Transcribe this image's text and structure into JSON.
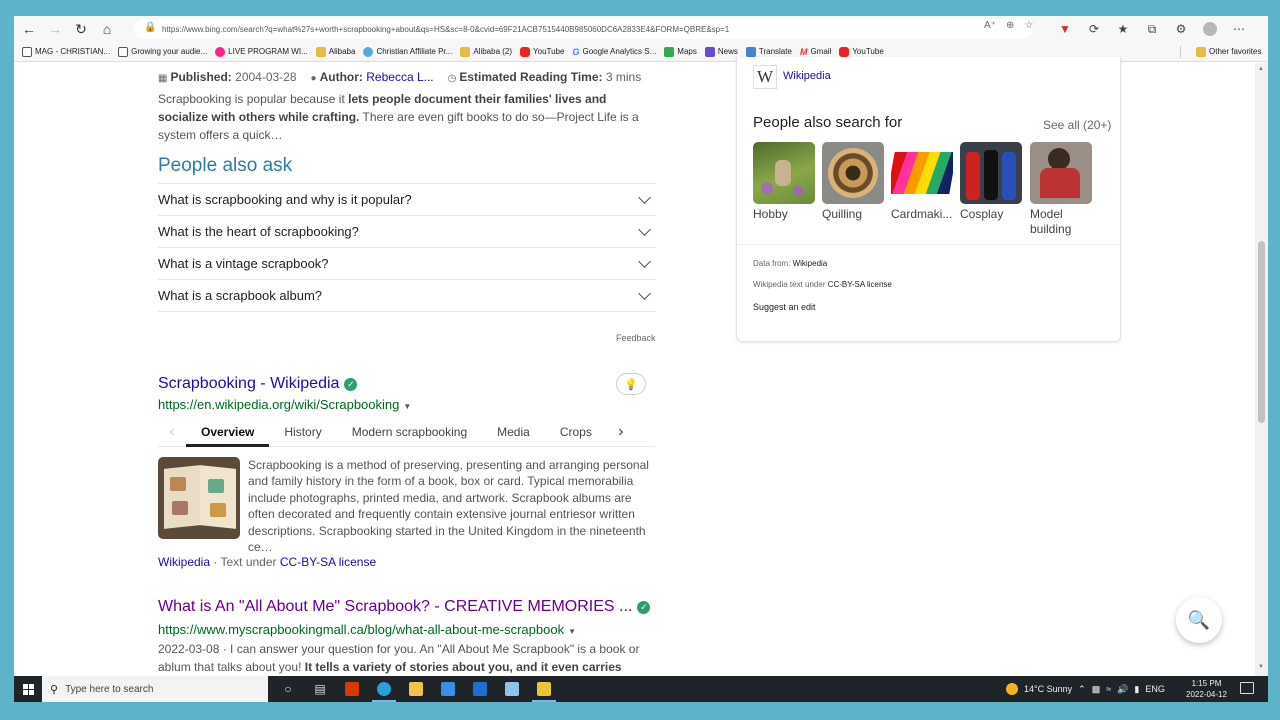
{
  "browser": {
    "url": "https://www.bing.com/search?q=what%27s+worth+scrapbooking+about&qs=HS&sc=8-0&cvid=69F21ACB7515440B985060DC6A2833E4&FORM=QBRE&sp=1",
    "bookmarks": [
      {
        "label": "MAG - CHRISTIAN...",
        "icon": "doc"
      },
      {
        "label": "Growing your audie...",
        "icon": "doc"
      },
      {
        "label": "LIVE PROGRAM WI...",
        "icon": "pink"
      },
      {
        "label": "Alibaba",
        "icon": "folder"
      },
      {
        "label": "Christian Affiliate Pr...",
        "icon": "blue"
      },
      {
        "label": "Alibaba (2)",
        "icon": "folder"
      },
      {
        "label": "YouTube",
        "icon": "yt"
      },
      {
        "label": "Google Analytics S...",
        "icon": "g"
      },
      {
        "label": "Maps",
        "icon": "maps"
      },
      {
        "label": "News",
        "icon": "news"
      },
      {
        "label": "Translate",
        "icon": "tr"
      },
      {
        "label": "Gmail",
        "icon": "gm"
      },
      {
        "label": "YouTube",
        "icon": "yt"
      }
    ],
    "other_favorites": "Other favorites"
  },
  "result1": {
    "published_label": "Published:",
    "published_value": "2004-03-28",
    "author_label": "Author:",
    "author_value": "Rebecca L...",
    "reading_label": "Estimated Reading Time:",
    "reading_value": "3 mins",
    "snippet_a": "Scrapbooking is popular because it ",
    "snippet_b": "lets people document their families' lives and socialize with others while crafting.",
    "snippet_c": " There are even gift books to do so—Project Life is a system offers a quick…"
  },
  "paa": {
    "title": "People also ask",
    "questions": [
      "What is scrapbooking and why is it popular?",
      "What is the heart of scrapbooking?",
      "What is a vintage scrapbook?",
      "What is a scrapbook album?"
    ],
    "feedback": "Feedback"
  },
  "wiki_result": {
    "title": "Scrapbooking - Wikipedia",
    "url": "https://en.wikipedia.org/wiki/Scrapbooking",
    "tabs": [
      "Overview",
      "History",
      "Modern scrapbooking",
      "Media",
      "Crops"
    ],
    "snippet": "Scrapbooking is a method of preserving, presenting and arranging personal and family history in the form of a book, box or card. Typical memorabilia include photographs, printed media, and artwork. Scrapbook albums are often decorated and frequently contain extensive journal entriesor written descriptions. Scrapbooking started in the United Kingdom in the nineteenth ce…",
    "source": "Wikipedia",
    "license_prefix": " · Text under ",
    "license": "CC-BY-SA license"
  },
  "result2": {
    "title": "What is An \"All About Me\" Scrapbook? - CREATIVE MEMORIES ...",
    "url": "https://www.myscrapbookingmall.ca/blog/what-all-about-me-scrapbook",
    "snippet_a": "2022-03-08 · I can answer your question for you. An \"All About Me Scrapbook\" is a book or ablum that talks about you! ",
    "snippet_b": "It tells a variety of stories about you, and it even carries pictures of you too…"
  },
  "panel": {
    "wiki_link": "Wikipedia",
    "pas_title": "People also search for",
    "see_all": "See all (20+)",
    "items": [
      {
        "label": "Hobby"
      },
      {
        "label": "Quilling"
      },
      {
        "label": "Cardmaki..."
      },
      {
        "label": "Cosplay"
      },
      {
        "label": "Model building"
      }
    ],
    "data_from_label": "Data from: ",
    "data_from_value": "Wikipedia",
    "license_label": "Wikipedia text under ",
    "license_value": "CC-BY-SA license",
    "suggest": "Suggest an edit"
  },
  "taskbar": {
    "search_placeholder": "Type here to search",
    "weather": "14°C  Sunny",
    "lang": "ENG",
    "time": "1:15 PM",
    "date": "2022-04-12"
  }
}
